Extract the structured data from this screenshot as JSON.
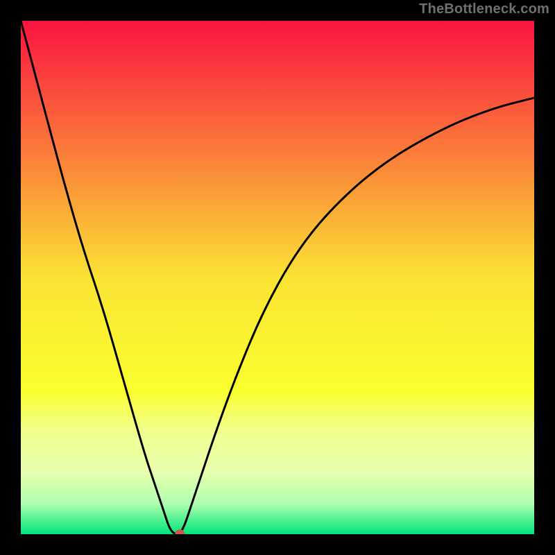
{
  "watermark": {
    "text": "TheBottleneck.com"
  },
  "chart_data": {
    "type": "line",
    "title": "",
    "xlabel": "",
    "ylabel": "",
    "xlim": [
      0,
      100
    ],
    "ylim": [
      0,
      100
    ],
    "grid": false,
    "legend": false,
    "background_gradient": {
      "stops": [
        {
          "offset": 0.0,
          "color": "#fa1440"
        },
        {
          "offset": 0.25,
          "color": "#fb793a"
        },
        {
          "offset": 0.5,
          "color": "#fbe334"
        },
        {
          "offset": 0.72,
          "color": "#faff2e"
        },
        {
          "offset": 0.8,
          "color": "#f2ff8f"
        },
        {
          "offset": 0.88,
          "color": "#e6ffae"
        },
        {
          "offset": 0.94,
          "color": "#b0ffb0"
        },
        {
          "offset": 1.0,
          "color": "#00e57a"
        }
      ]
    },
    "series": [
      {
        "name": "bottleneck-curve",
        "color": "#000000",
        "x": [
          0,
          4,
          8,
          12,
          16,
          20,
          24,
          26,
          28,
          29,
          30,
          31,
          32,
          33,
          35,
          38,
          42,
          47,
          53,
          60,
          70,
          82,
          92,
          100
        ],
        "y": [
          100,
          85,
          70,
          56,
          44,
          30,
          16,
          10,
          4,
          1,
          0,
          0,
          2,
          5,
          11,
          20,
          31,
          43,
          54,
          63,
          72,
          79,
          83,
          85
        ]
      }
    ],
    "marker": {
      "name": "optimal-point",
      "x": 31,
      "y": 0,
      "color": "#cc5a4a",
      "radius_px": 7
    }
  }
}
